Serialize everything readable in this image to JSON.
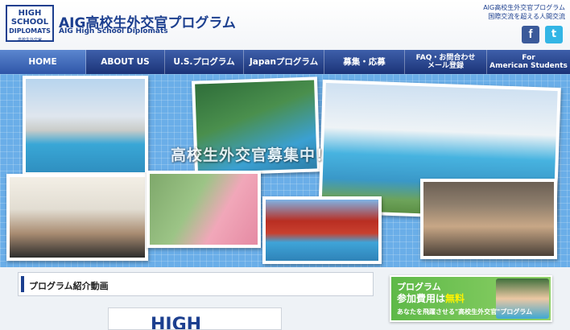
{
  "header": {
    "logo": {
      "line1": "HIGH",
      "line2": "SCHOOL",
      "line3": "DIPLOMATS",
      "line4": "高校生外交官"
    },
    "title": "AIG高校生外交官プログラム",
    "subtitle": "AIG High School Diplomats",
    "tagline1": "AIG高校生外交官プログラム",
    "tagline2": "国際交流を超える人間交流",
    "social": {
      "facebook_glyph": "f",
      "twitter_glyph": "t"
    }
  },
  "nav": {
    "items": [
      {
        "label": "HOME",
        "active": true
      },
      {
        "label": "ABOUT US"
      },
      {
        "label": "U.S.プログラム"
      },
      {
        "label": "Japanプログラム"
      },
      {
        "label": "募集・応募"
      },
      {
        "label_line1": "FAQ・お問合わせ",
        "label_line2": "メール登録"
      },
      {
        "label_line1": "For",
        "label_line2": "American Students"
      }
    ]
  },
  "hero": {
    "caption": "高校生外交官募集中！"
  },
  "content": {
    "section_title": "プログラム紹介動画",
    "video_logo": "HIGH"
  },
  "banner": {
    "line1": "プログラム",
    "line2_prefix": "参加費用は",
    "line2_highlight": "無料",
    "line3": "あなたを飛躍させる\"高校生外交官\"プログラム"
  }
}
